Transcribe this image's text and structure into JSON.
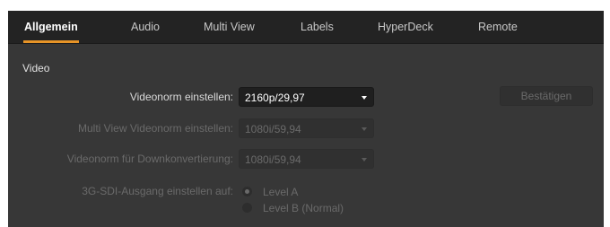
{
  "tabs": [
    {
      "label": "Allgemein",
      "active": true
    },
    {
      "label": "Audio",
      "active": false
    },
    {
      "label": "Multi View",
      "active": false
    },
    {
      "label": "Labels",
      "active": false
    },
    {
      "label": "HyperDeck",
      "active": false
    },
    {
      "label": "Remote",
      "active": false
    }
  ],
  "accent_color": "#e79427",
  "video": {
    "section_title": "Video",
    "video_format": {
      "label": "Videonorm einstellen:",
      "value": "2160p/29,97",
      "enabled": true
    },
    "confirm_button": {
      "label": "Bestätigen",
      "enabled": false
    },
    "multiview_format": {
      "label": "Multi View Videonorm einstellen:",
      "value": "1080i/59,94",
      "enabled": false
    },
    "downconvert_format": {
      "label": "Videonorm für Downkonvertierung:",
      "value": "1080i/59,94",
      "enabled": false
    },
    "sdi_output": {
      "label": "3G-SDI-Ausgang einstellen auf:",
      "options": [
        {
          "label": "Level A",
          "selected": true
        },
        {
          "label": "Level B (Normal)",
          "selected": false
        }
      ],
      "enabled": false
    }
  }
}
